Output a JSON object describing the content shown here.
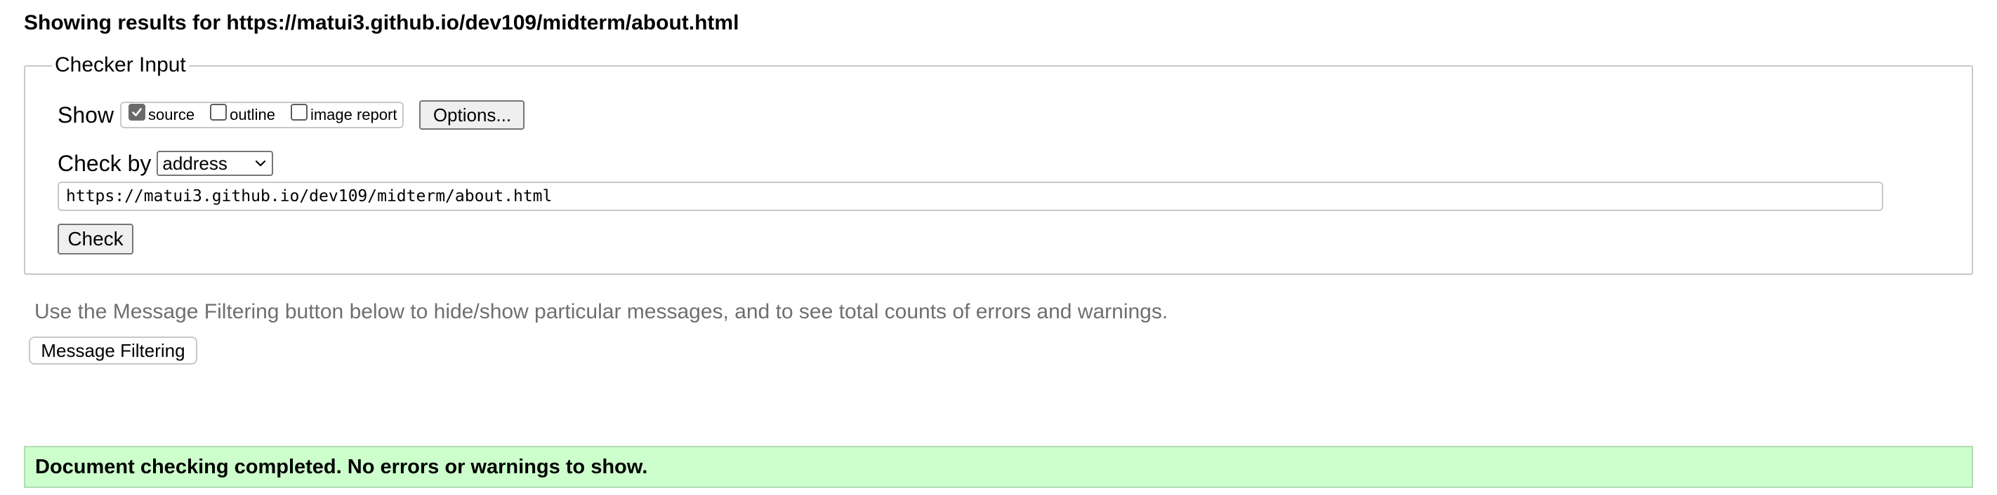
{
  "results": {
    "heading_prefix": "Showing results for",
    "url": "https://matui3.github.io/dev109/midterm/about.html"
  },
  "checker": {
    "legend": "Checker Input",
    "show_label": "Show",
    "show_options": [
      {
        "label": "source",
        "checked": true
      },
      {
        "label": "outline",
        "checked": false
      },
      {
        "label": "image report",
        "checked": false
      }
    ],
    "options_button": "Options...",
    "check_by_label": "Check by",
    "check_by_selected": "address",
    "url_value": "https://matui3.github.io/dev109/midterm/about.html",
    "check_button": "Check"
  },
  "filtering": {
    "hint": "Use the Message Filtering button below to hide/show particular messages, and to see total counts of errors and warnings.",
    "button": "Message Filtering"
  },
  "status": {
    "message": "Document checking completed. No errors or warnings to show.",
    "color": "#ccffcc"
  },
  "icons": {
    "checkbox_checked": "check-icon",
    "select_arrow": "chevron-down-icon"
  }
}
